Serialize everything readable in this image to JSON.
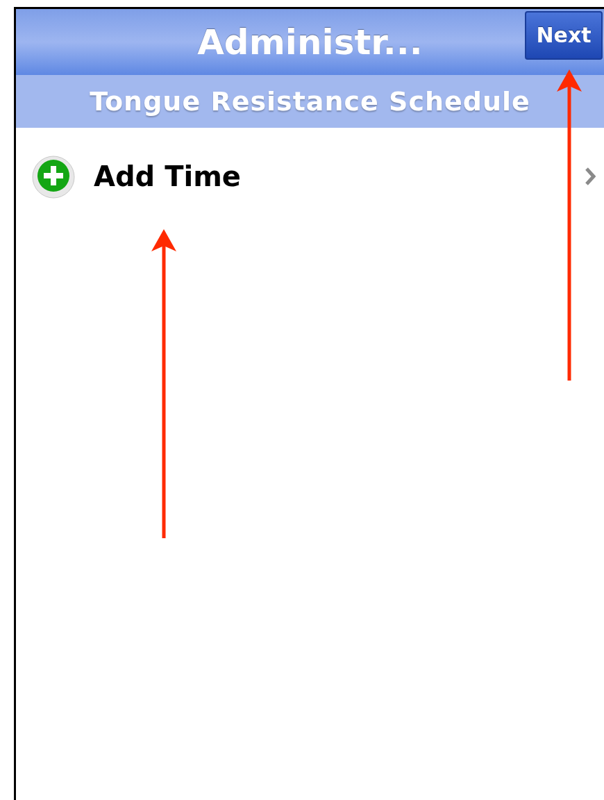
{
  "nav_bar": {
    "title": "Administr...",
    "next_button": "Next"
  },
  "subtitle": "Tongue Resistance Schedule",
  "list": [
    {
      "kind": "add",
      "label": "Add Time"
    }
  ],
  "annotations": [
    {
      "kind": "arrow"
    },
    {
      "kind": "arrow"
    }
  ]
}
